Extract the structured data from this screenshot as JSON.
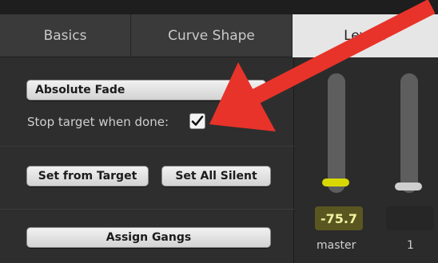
{
  "tabs": [
    {
      "label": "Basics",
      "active": false
    },
    {
      "label": "Curve Shape",
      "active": false
    },
    {
      "label": "Levels",
      "active": true
    }
  ],
  "fade_type": {
    "label": "Absolute Fade"
  },
  "stop_target": {
    "label": "Stop target when done:",
    "checked": true
  },
  "buttons": {
    "set_from_target": "Set from Target",
    "set_all_silent": "Set All Silent",
    "assign_gangs": "Assign Gangs"
  },
  "levels": {
    "channels": [
      {
        "name": "master",
        "value": "-75.7",
        "handle_color": "#d8d800"
      },
      {
        "name": "1",
        "value": "",
        "handle_color": "#cfcfcf"
      }
    ]
  },
  "colors": {
    "accent_arrow": "#e8332a",
    "readout_master_bg": "#5a5620",
    "readout_master_text": "#f2f2a0"
  }
}
